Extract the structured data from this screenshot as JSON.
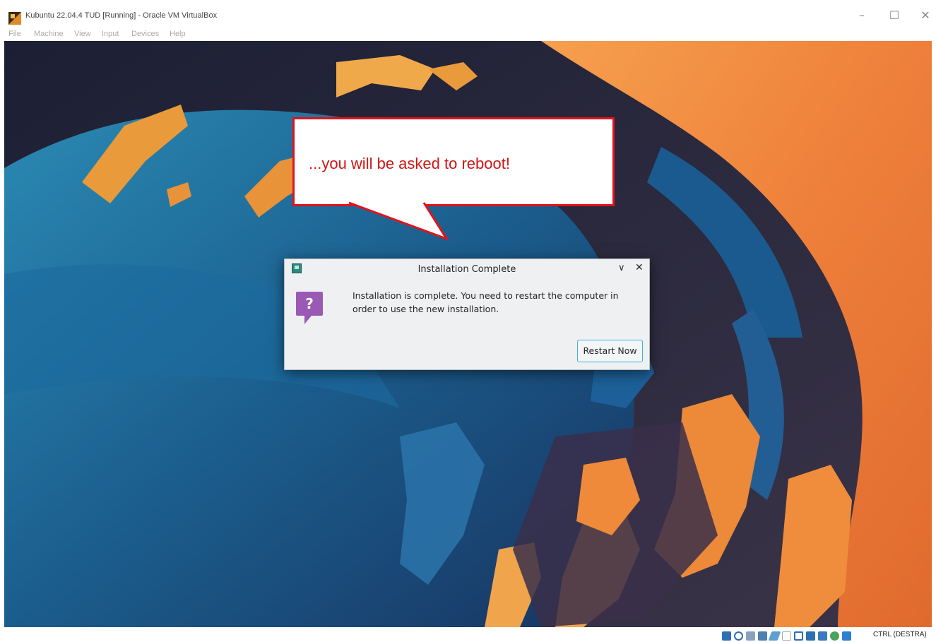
{
  "window": {
    "title": "Kubuntu 22.04.4 TUD [Running] - Oracle VM VirtualBox",
    "controls": {
      "minimize": "–",
      "maximize": "☐",
      "close": "✕"
    }
  },
  "menu": [
    "File",
    "Machine",
    "View",
    "Input",
    "Devices",
    "Help"
  ],
  "callout": {
    "text": "...you will be asked to reboot!"
  },
  "dialog": {
    "title": "Installation Complete",
    "message": "Installation is complete. You need to restart the computer in order to use the new installation.",
    "icon": "?",
    "button": "Restart Now",
    "collapse_glyph": "∨",
    "close_glyph": "✕"
  },
  "statusbar": {
    "host_key": "CTRL (DESTRA)",
    "icons": [
      "hard-disk-icon",
      "optical-drive-icon",
      "audio-icon",
      "network-icon",
      "usb-icon",
      "shared-folders-icon",
      "display-icon",
      "video-capture-icon",
      "cpu-icon",
      "recording-icon",
      "mouse-integration-icon"
    ]
  },
  "colors": {
    "callout_border": "#e3121b",
    "callout_text": "#d21414",
    "focus_blue": "#3daee9",
    "question_purple": "#9b59b6",
    "wallpaper_blue": "#1c5c8a",
    "wallpaper_orange": "#f08a3c"
  }
}
